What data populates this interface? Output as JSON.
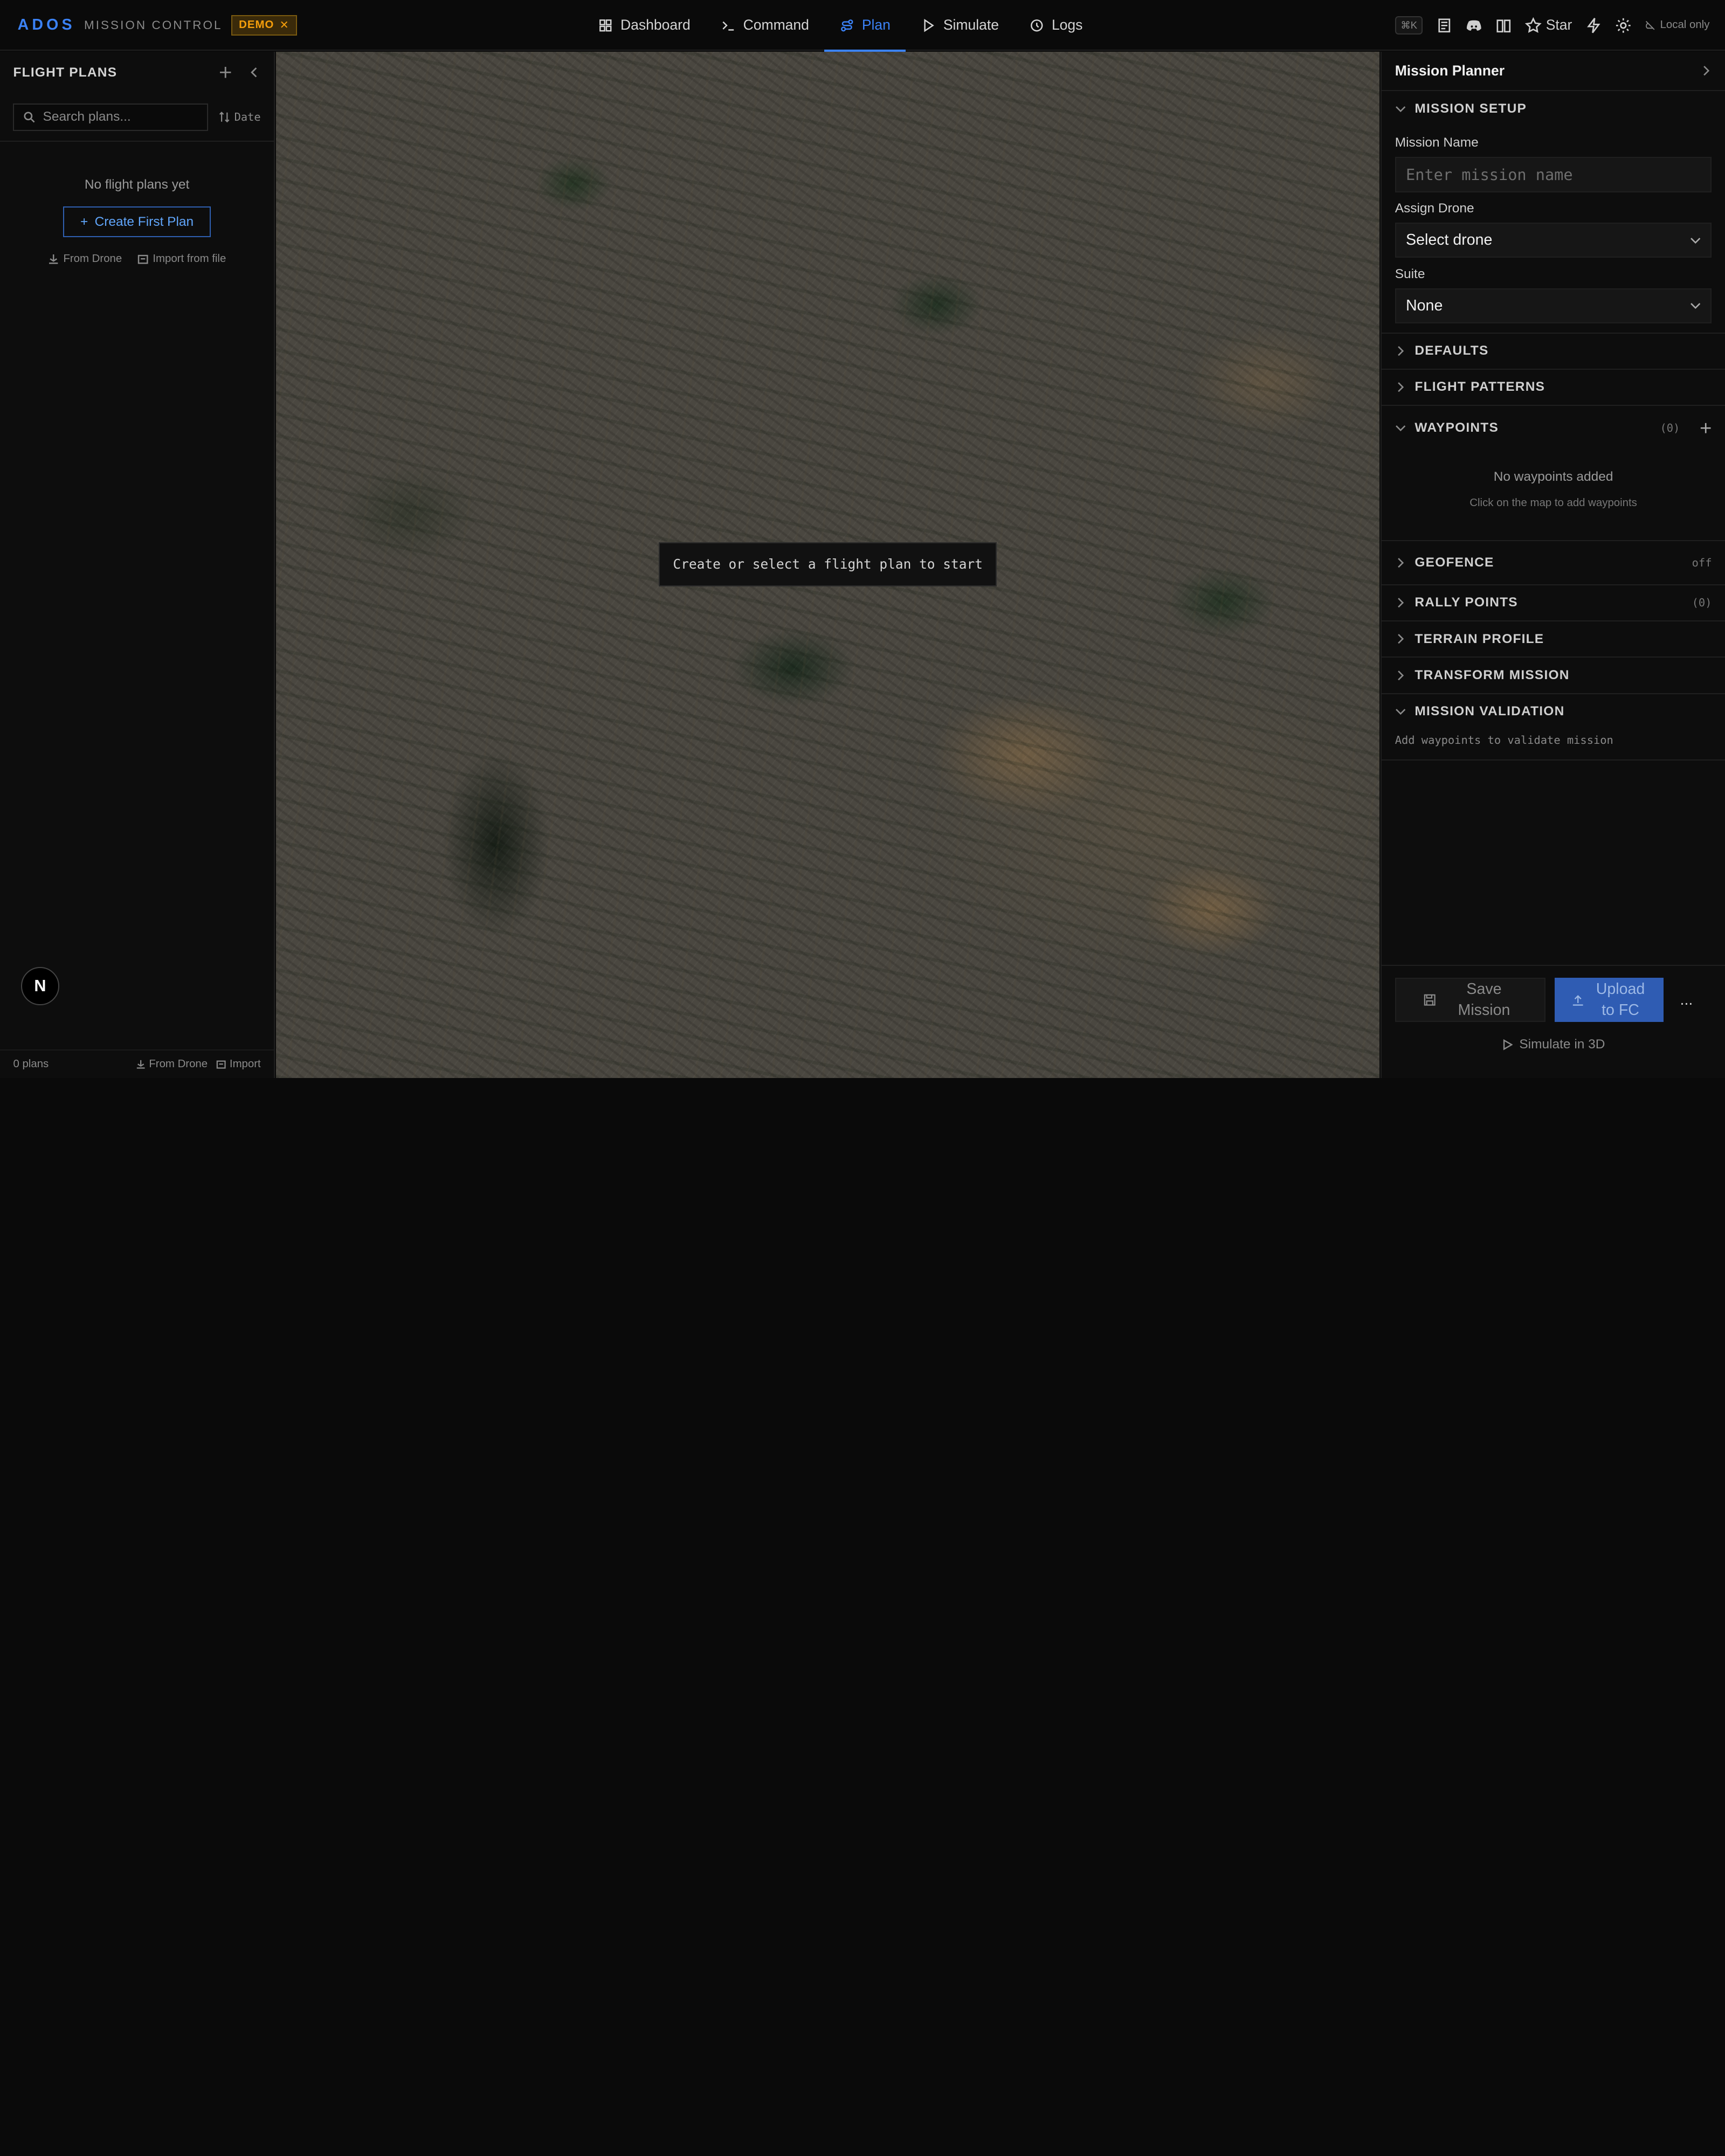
{
  "brand": {
    "name": "ADOS",
    "subtitle": "MISSION CONTROL",
    "badge": "DEMO"
  },
  "nav": [
    {
      "label": "Dashboard",
      "icon": "dashboard-icon"
    },
    {
      "label": "Command",
      "icon": "terminal-icon"
    },
    {
      "label": "Plan",
      "icon": "route-icon",
      "active": true
    },
    {
      "label": "Simulate",
      "icon": "play-icon"
    },
    {
      "label": "Logs",
      "icon": "history-icon"
    }
  ],
  "toolbar": {
    "shortcut": "⌘K",
    "star_label": "Star",
    "local_label": "Local only"
  },
  "flight_plans": {
    "title": "FLIGHT PLANS",
    "search_placeholder": "Search plans...",
    "sort_label": "Date",
    "empty_text": "No flight plans yet",
    "create_label": "Create First Plan",
    "from_drone": "From Drone",
    "import_file": "Import from file",
    "footer_count": "0 plans",
    "footer_from_drone": "From Drone",
    "footer_import": "Import"
  },
  "map": {
    "message": "Create or select a flight plan to start"
  },
  "planner": {
    "title": "Mission Planner",
    "setup": {
      "title": "MISSION SETUP",
      "name_label": "Mission Name",
      "name_placeholder": "Enter mission name",
      "drone_label": "Assign Drone",
      "drone_value": "Select drone",
      "suite_label": "Suite",
      "suite_value": "None"
    },
    "defaults": "DEFAULTS",
    "flight_patterns": "FLIGHT PATTERNS",
    "waypoints": {
      "title": "WAYPOINTS",
      "count": "(0)",
      "empty": "No waypoints added",
      "hint": "Click on the map to add waypoints"
    },
    "geofence": {
      "title": "GEOFENCE",
      "status": "off"
    },
    "rally": {
      "title": "RALLY POINTS",
      "count": "(0)"
    },
    "terrain": "TERRAIN PROFILE",
    "transform": "TRANSFORM MISSION",
    "validation": {
      "title": "MISSION VALIDATION",
      "message": "Add waypoints to validate mission"
    },
    "save_label": "Save Mission",
    "upload_label": "Upload to FC",
    "more": "...",
    "simulate_label": "Simulate in 3D"
  },
  "colors": {
    "accent": "#3b82f6",
    "badge": "#f59e0b",
    "background": "#0a0a0a"
  }
}
